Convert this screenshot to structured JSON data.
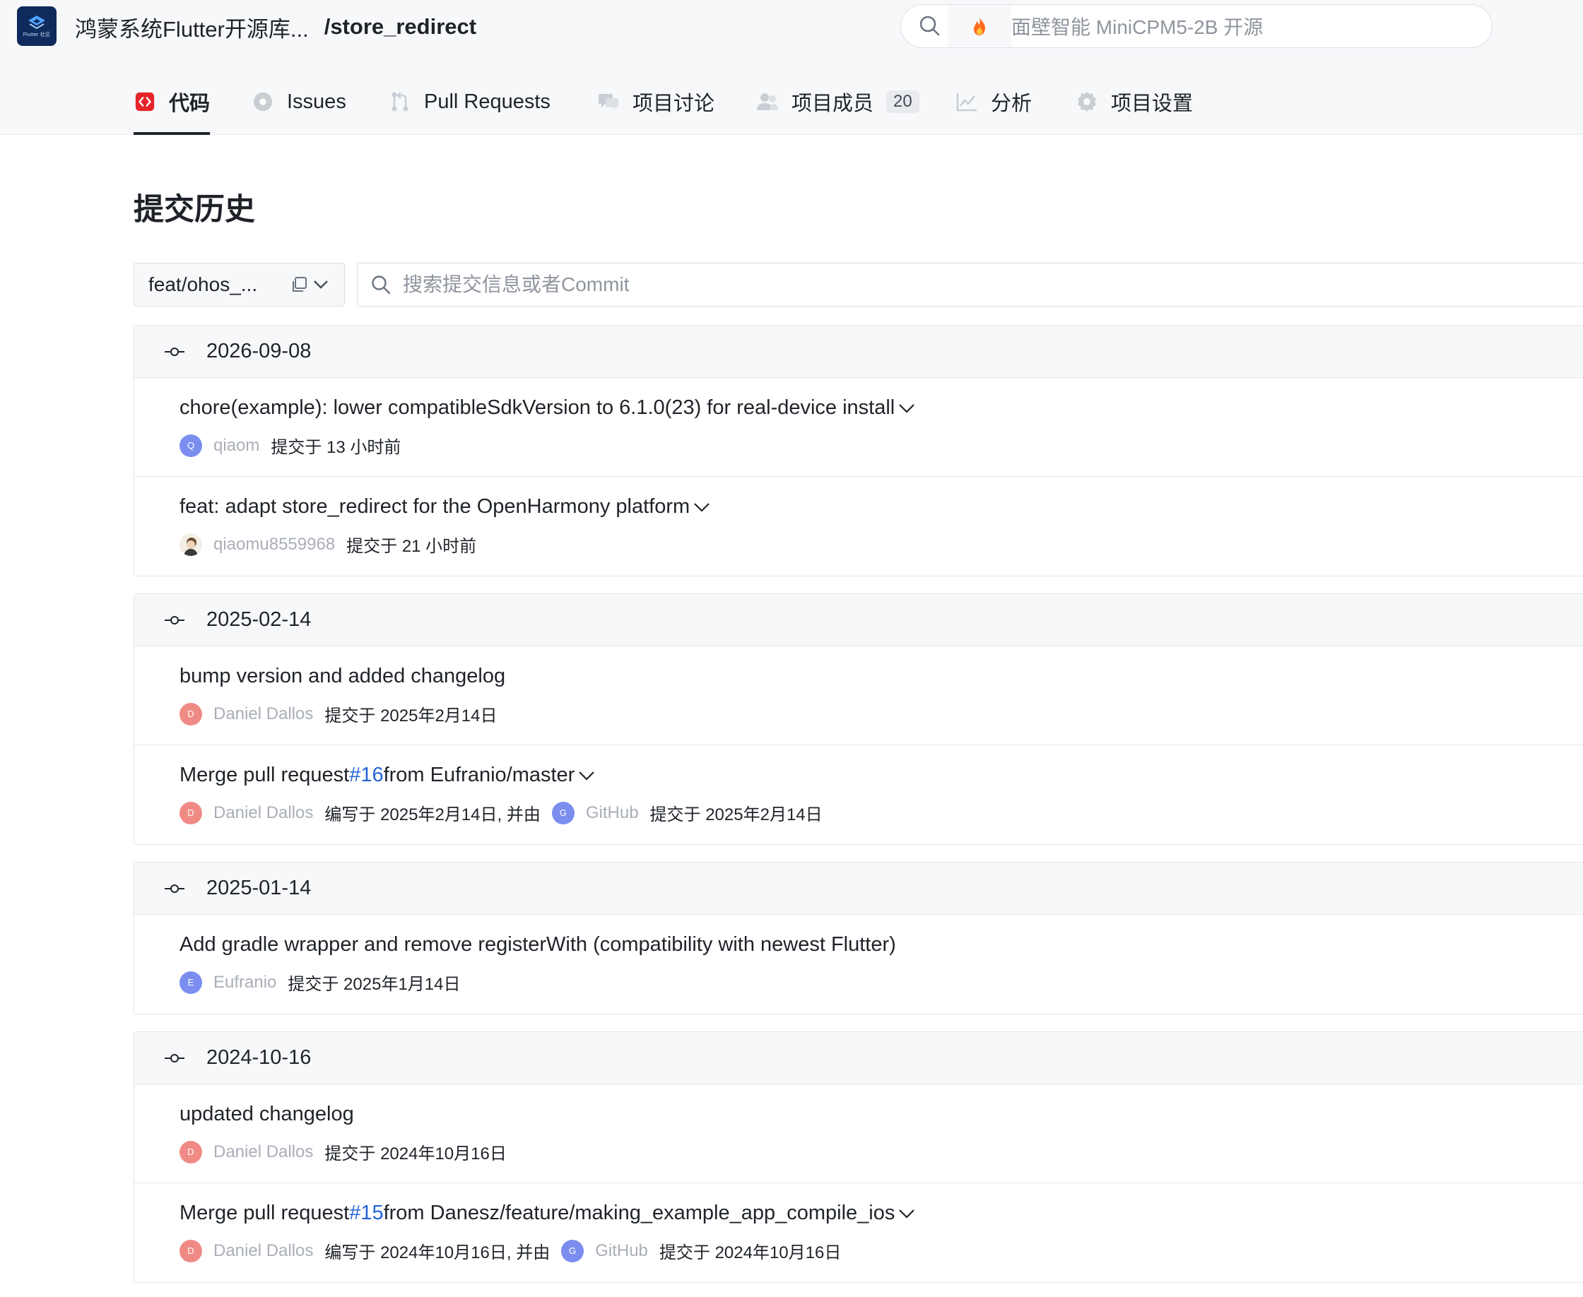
{
  "header": {
    "logo_alt": "鸿蒙版 Flutter社区",
    "repo_owner": "鸿蒙系统Flutter开源库...",
    "repo_name": "/store_redirect",
    "search_placeholder": "面壁智能 MiniCPM5-2B 开源"
  },
  "tabs": [
    {
      "label": "代码",
      "active": true
    },
    {
      "label": "Issues"
    },
    {
      "label": "Pull Requests"
    },
    {
      "label": "项目讨论"
    },
    {
      "label": "项目成员",
      "badge": "20"
    },
    {
      "label": "分析"
    },
    {
      "label": "项目设置"
    }
  ],
  "page": {
    "title": "提交历史",
    "branch": "feat/ohos_...",
    "commit_search_placeholder": "搜索提交信息或者Commit"
  },
  "colors": {
    "accent": "#2563d9",
    "avatar_blue": "#7b8ef0",
    "avatar_red": "#f08a84",
    "tab_code_red": "#e5252a"
  },
  "groups": [
    {
      "date": "2026-09-08",
      "commits": [
        {
          "title": "chore(example): lower compatibleSdkVersion to 6.1.0(23) for real-device install",
          "expand": true,
          "avatar": "Q",
          "author": "qiaom",
          "info": "提交于 13 小时前"
        },
        {
          "title": "feat: adapt store_redirect for the OpenHarmony platform",
          "expand": true,
          "avatar": "photo",
          "author": "qiaomu8559968",
          "info": "提交于 21 小时前"
        }
      ]
    },
    {
      "date": "2025-02-14",
      "commits": [
        {
          "title": "bump version and added changelog",
          "avatar": "D",
          "author": "Daniel Dallos",
          "info": "提交于 2025年2月14日"
        },
        {
          "title_pre": "Merge pull request ",
          "pr": "#16",
          "title_post": " from Eufranio/master",
          "expand": true,
          "avatar": "D",
          "author": "Daniel Dallos",
          "info": "编写于 2025年2月14日, 并由",
          "avatar2": "G",
          "author2": "GitHub",
          "info2": "提交于 2025年2月14日"
        }
      ]
    },
    {
      "date": "2025-01-14",
      "commits": [
        {
          "title": "Add gradle wrapper and remove registerWith (compatibility with newest Flutter)",
          "avatar": "E",
          "author": "Eufranio",
          "info": "提交于 2025年1月14日"
        }
      ]
    },
    {
      "date": "2024-10-16",
      "commits": [
        {
          "title": "updated changelog",
          "avatar": "D",
          "author": "Daniel Dallos",
          "info": "提交于 2024年10月16日"
        },
        {
          "title_pre": "Merge pull request ",
          "pr": "#15",
          "title_post": " from Danesz/feature/making_example_app_compile_ios",
          "expand": true,
          "avatar": "D",
          "author": "Daniel Dallos",
          "info": "编写于 2024年10月16日, 并由",
          "avatar2": "G",
          "author2": "GitHub",
          "info2": "提交于 2024年10月16日"
        }
      ]
    }
  ]
}
